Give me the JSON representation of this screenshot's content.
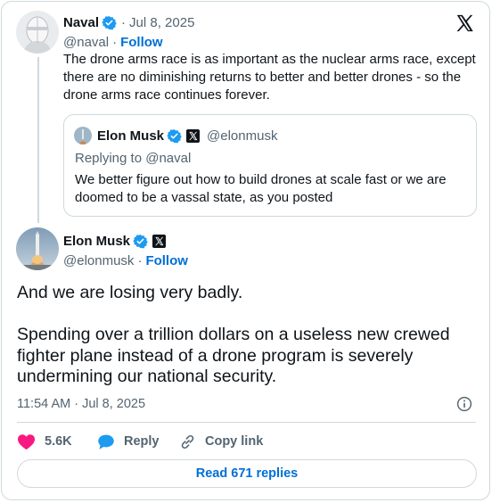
{
  "parent_tweet": {
    "author_name": "Naval",
    "handle": "@naval",
    "date_sep": "·",
    "date": "Jul 8, 2025",
    "follow_sep": "·",
    "follow_label": "Follow",
    "text": "The drone arms race is as important as the nuclear arms race, except there are no diminishing returns to better and better drones - so the drone arms race continues forever."
  },
  "quoted_tweet": {
    "author_name": "Elon Musk",
    "handle": "@elonmusk",
    "replying_to": "Replying to @naval",
    "text": "We better figure out how to build drones at scale fast or we are doomed to be a vassal state, as you posted"
  },
  "main_tweet": {
    "author_name": "Elon Musk",
    "handle": "@elonmusk",
    "follow_sep": "·",
    "follow_label": "Follow",
    "paragraph_1": "And we are losing very badly.",
    "paragraph_2": "Spending over a trillion dollars on a useless new crewed fighter plane instead of a drone program is severely undermining our national security.",
    "timestamp": "11:54 AM · Jul 8, 2025"
  },
  "actions": {
    "likes_count": "5.6K",
    "reply_label": "Reply",
    "copy_link_label": "Copy link"
  },
  "read_replies_label": "Read 671 replies",
  "icons": {
    "logo": "x-logo-icon",
    "verified": "verified-badge-icon",
    "org_badge": "x-org-badge-icon",
    "info": "info-icon",
    "like": "heart-icon",
    "reply": "speech-bubble-icon",
    "copy": "link-icon"
  },
  "colors": {
    "accent": "#006fd6",
    "verified": "#1d9bf0",
    "like": "#f91880",
    "text": "#0f1419",
    "muted": "#536471",
    "border": "#cfd9de"
  }
}
